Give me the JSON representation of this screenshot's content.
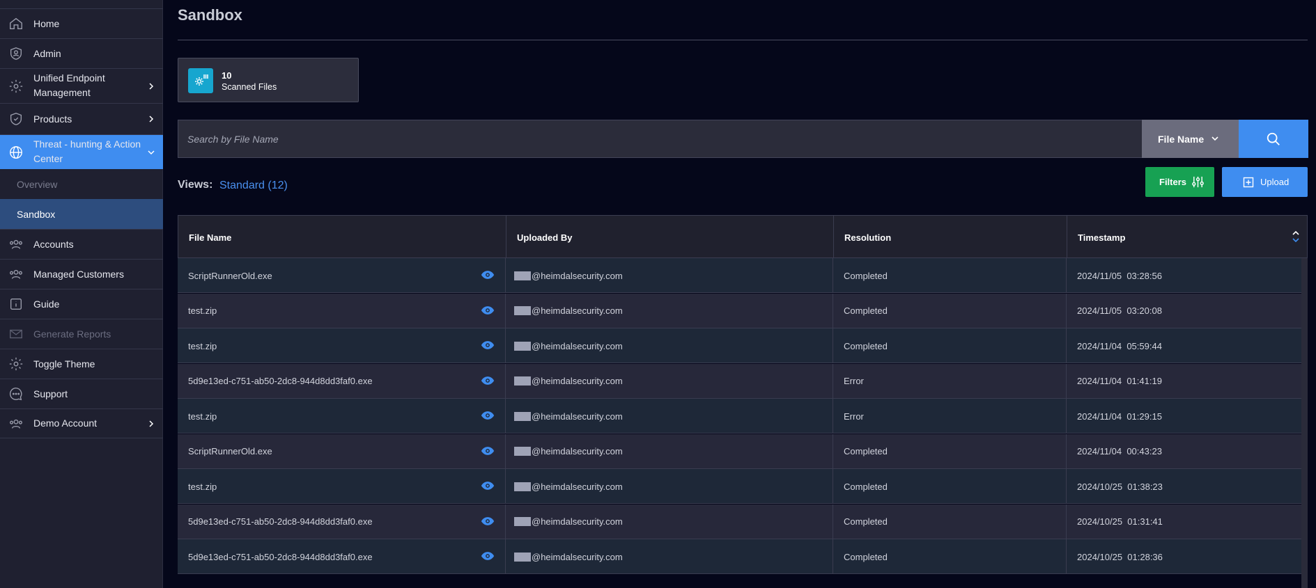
{
  "sidebar": {
    "items": [
      {
        "label": "Home",
        "icon": "home-icon"
      },
      {
        "label": "Admin",
        "icon": "admin-shield-icon"
      },
      {
        "label": "Unified Endpoint",
        "label2": "Management",
        "icon": "gear-icon"
      },
      {
        "label": "Products",
        "icon": "shield-icon"
      },
      {
        "label": "Threat - hunting & Action",
        "label2": "Center",
        "icon": "globe-icon"
      },
      {
        "label": "Accounts",
        "icon": "users-icon"
      },
      {
        "label": "Managed Customers",
        "icon": "users-icon"
      },
      {
        "label": "Guide",
        "icon": "info-icon"
      },
      {
        "label": "Generate Reports",
        "icon": "mail-icon"
      },
      {
        "label": "Toggle Theme",
        "icon": "gear-icon"
      },
      {
        "label": "Support",
        "icon": "chat-icon"
      },
      {
        "label": "Demo Account",
        "icon": "users-icon"
      }
    ],
    "subitems": [
      {
        "label": "Overview"
      },
      {
        "label": "Sandbox"
      }
    ],
    "active_color": "#3f8df0"
  },
  "page": {
    "title": "Sandbox"
  },
  "stat": {
    "count": "10",
    "caption": "Scanned Files"
  },
  "search": {
    "placeholder": "Search by File Name",
    "field": "File Name"
  },
  "views": {
    "label": "Views:",
    "value": "Standard (12)"
  },
  "actions": {
    "filters": "Filters",
    "upload": "Upload"
  },
  "table": {
    "columns": [
      "File Name",
      "Uploaded By",
      "Resolution",
      "Timestamp"
    ],
    "rows": [
      {
        "file": "ScriptRunnerOld.exe",
        "user": "@heimdalsecurity.com",
        "resolution": "Completed",
        "timestamp": "2024/11/05  03:28:56"
      },
      {
        "file": "test.zip",
        "user": "@heimdalsecurity.com",
        "resolution": "Completed",
        "timestamp": "2024/11/05  03:20:08"
      },
      {
        "file": "test.zip",
        "user": "@heimdalsecurity.com",
        "resolution": "Completed",
        "timestamp": "2024/11/04  05:59:44"
      },
      {
        "file": "5d9e13ed-c751-ab50-2dc8-944d8dd3faf0.exe",
        "user": "@heimdalsecurity.com",
        "resolution": "Error",
        "timestamp": "2024/11/04  01:41:19"
      },
      {
        "file": "test.zip",
        "user": "@heimdalsecurity.com",
        "resolution": "Error",
        "timestamp": "2024/11/04  01:29:15"
      },
      {
        "file": "ScriptRunnerOld.exe",
        "user": "@heimdalsecurity.com",
        "resolution": "Completed",
        "timestamp": "2024/11/04  00:43:23"
      },
      {
        "file": "test.zip",
        "user": "@heimdalsecurity.com",
        "resolution": "Completed",
        "timestamp": "2024/10/25  01:38:23"
      },
      {
        "file": "5d9e13ed-c751-ab50-2dc8-944d8dd3faf0.exe",
        "user": "@heimdalsecurity.com",
        "resolution": "Completed",
        "timestamp": "2024/10/25  01:31:41"
      },
      {
        "file": "5d9e13ed-c751-ab50-2dc8-944d8dd3faf0.exe",
        "user": "@heimdalsecurity.com",
        "resolution": "Completed",
        "timestamp": "2024/10/25  01:28:36"
      }
    ]
  }
}
